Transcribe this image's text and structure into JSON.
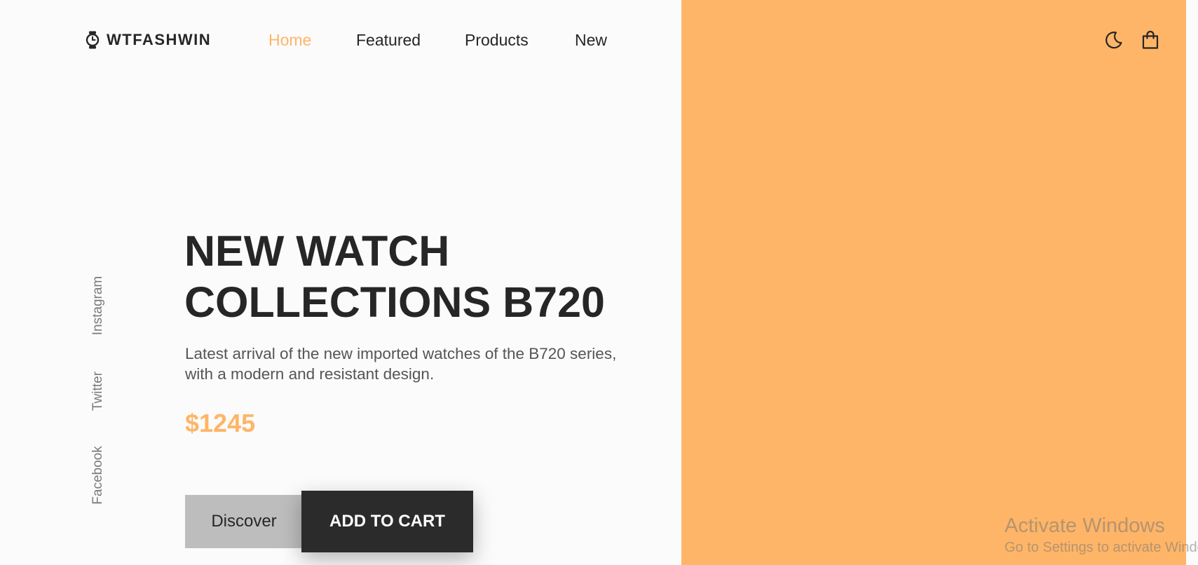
{
  "header": {
    "brand": "WTFASHWIN",
    "logo_icon": "watch-icon",
    "nav": [
      {
        "label": "Home",
        "active": true
      },
      {
        "label": "Featured",
        "active": false
      },
      {
        "label": "Products",
        "active": false
      },
      {
        "label": "New",
        "active": false
      }
    ],
    "icons": [
      "moon-icon",
      "shopping-bag-icon"
    ]
  },
  "social": [
    "Instagram",
    "Twitter",
    "Facebook"
  ],
  "hero": {
    "title_line1": "NEW WATCH",
    "title_line2": "COLLECTIONS B720",
    "description": "Latest arrival of the new imported watches of the B720 series, with a modern and resistant design.",
    "price": "$1245",
    "discover_label": "Discover",
    "add_to_cart_label": "ADD TO CART"
  },
  "watermark": {
    "title": "Activate Windows",
    "subtitle": "Go to Settings to activate Windows."
  },
  "colors": {
    "accent": "#ffb567",
    "text_dark": "#262626",
    "background": "#fbfbfb",
    "cart_button": "#2b2b2b",
    "discover_button": "#bdbdbd"
  }
}
